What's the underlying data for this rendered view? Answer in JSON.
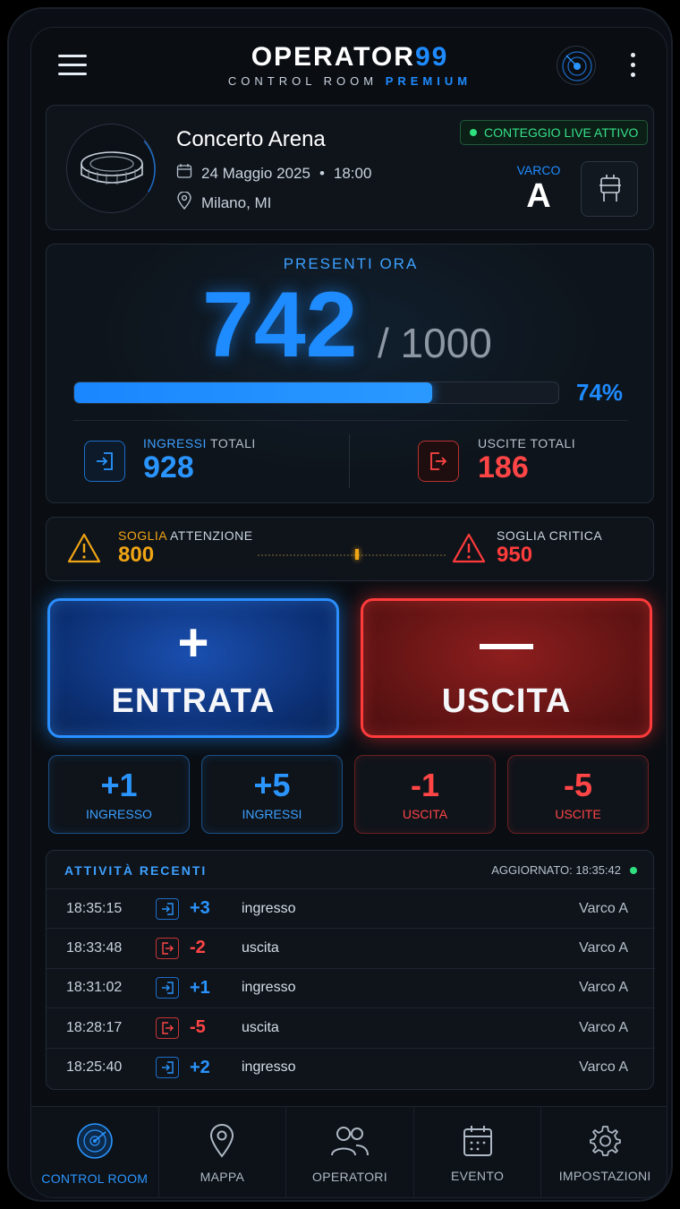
{
  "header": {
    "logo_main": "OPERATOR",
    "logo_accent": "99",
    "logo_sub": "CONTROL ROOM",
    "logo_sub_accent": "PREMIUM",
    "menu_icon": "hamburger-icon",
    "radar_icon": "radar-icon",
    "more_icon": "more-vertical-icon"
  },
  "event": {
    "name": "Concerto Arena",
    "date": "24 Maggio 2025",
    "time": "18:00",
    "location": "Milano, MI",
    "live_badge": "CONTEGGIO LIVE ATTIVO",
    "gate_label": "VARCO",
    "gate_value": "A"
  },
  "occupancy": {
    "title": "PRESENTI ORA",
    "current": "742",
    "capacity": "/ 1000",
    "percent_label": "74%",
    "fill_fraction": 0.74,
    "entries_label_hl": "INGRESSI",
    "entries_label": "TOTALI",
    "entries_value": "928",
    "exits_label": "USCITE TOTALI",
    "exits_value": "186"
  },
  "thresholds": {
    "warning_label_hl": "SOGLIA",
    "warning_label": "ATTENZIONE",
    "warning_value": "800",
    "critical_label": "SOGLIA CRITICA",
    "critical_value": "950"
  },
  "actions": {
    "entry_symbol": "+",
    "entry_label": "ENTRATA",
    "exit_symbol": "—",
    "exit_label": "USCITA"
  },
  "quick": [
    {
      "value": "+1",
      "label": "INGRESSO"
    },
    {
      "value": "+5",
      "label": "INGRESSI"
    },
    {
      "value": "-1",
      "label": "USCITA"
    },
    {
      "value": "-5",
      "label": "USCITE"
    }
  ],
  "activity": {
    "title": "ATTIVITÀ RECENTI",
    "updated": "AGGIORNATO: 18:35:42",
    "rows": [
      {
        "time": "18:35:15",
        "kind": "in",
        "delta": "+3",
        "type": "ingresso",
        "gate": "Varco A"
      },
      {
        "time": "18:33:48",
        "kind": "out",
        "delta": "-2",
        "type": "uscita",
        "gate": "Varco A"
      },
      {
        "time": "18:31:02",
        "kind": "in",
        "delta": "+1",
        "type": "ingresso",
        "gate": "Varco A"
      },
      {
        "time": "18:28:17",
        "kind": "out",
        "delta": "-5",
        "type": "uscita",
        "gate": "Varco A"
      },
      {
        "time": "18:25:40",
        "kind": "in",
        "delta": "+2",
        "type": "ingresso",
        "gate": "Varco A"
      }
    ]
  },
  "nav": [
    {
      "label": "CONTROL ROOM",
      "icon": "radar-icon",
      "active": true
    },
    {
      "label": "MAPPA",
      "icon": "map-pin-icon",
      "active": false
    },
    {
      "label": "OPERATORI",
      "icon": "users-icon",
      "active": false
    },
    {
      "label": "EVENTO",
      "icon": "calendar-icon",
      "active": false
    },
    {
      "label": "IMPOSTAZIONI",
      "icon": "gear-icon",
      "active": false
    }
  ],
  "colors": {
    "accent_blue": "#1e8bff",
    "accent_red": "#ff3b3b",
    "warning": "#f0a514",
    "live_green": "#2fe07f"
  }
}
